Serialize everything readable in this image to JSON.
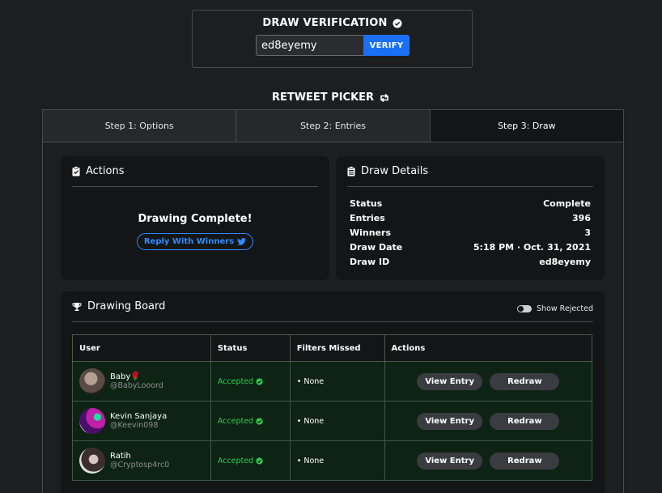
{
  "verification": {
    "title": "DRAW VERIFICATION",
    "input_value": "ed8eyemy",
    "verify_label": "VERIFY"
  },
  "picker": {
    "title": "RETWEET PICKER",
    "tabs": [
      {
        "label": "Step 1: Options",
        "active": false
      },
      {
        "label": "Step 2: Entries",
        "active": false
      },
      {
        "label": "Step 3: Draw",
        "active": true
      }
    ]
  },
  "actions": {
    "title": "Actions",
    "status_text": "Drawing Complete!",
    "reply_label": "Reply With Winners"
  },
  "details": {
    "title": "Draw Details",
    "rows": [
      {
        "label": "Status",
        "value": "Complete"
      },
      {
        "label": "Entries",
        "value": "396"
      },
      {
        "label": "Winners",
        "value": "3"
      },
      {
        "label": "Draw Date",
        "value": "5:18 PM · Oct. 31, 2021"
      },
      {
        "label": "Draw ID",
        "value": "ed8eyemy"
      }
    ]
  },
  "board": {
    "title": "Drawing Board",
    "show_rejected_label": "Show Rejected",
    "columns": [
      "User",
      "Status",
      "Filters Missed",
      "Actions"
    ],
    "rows": [
      {
        "name": "Baby🌹",
        "handle": "@BabyLooord",
        "status": "Accepted",
        "filters": "• None",
        "view_label": "View Entry",
        "redraw_label": "Redraw",
        "avatar_color": "#6b5d55"
      },
      {
        "name": "Kevin Sanjaya",
        "handle": "@Keevin098",
        "status": "Accepted",
        "filters": "• None",
        "view_label": "View Entry",
        "redraw_label": "Redraw",
        "avatar_color": "#8a1fa8"
      },
      {
        "name": "Ratih",
        "handle": "@Cryptosp4rc0",
        "status": "Accepted",
        "filters": "• None",
        "view_label": "View Entry",
        "redraw_label": "Redraw",
        "avatar_color": "#3d3434"
      }
    ]
  },
  "colors": {
    "accent": "#1a6ff5",
    "accepted": "#2ecc4f",
    "row_bg": "#0e2314"
  }
}
